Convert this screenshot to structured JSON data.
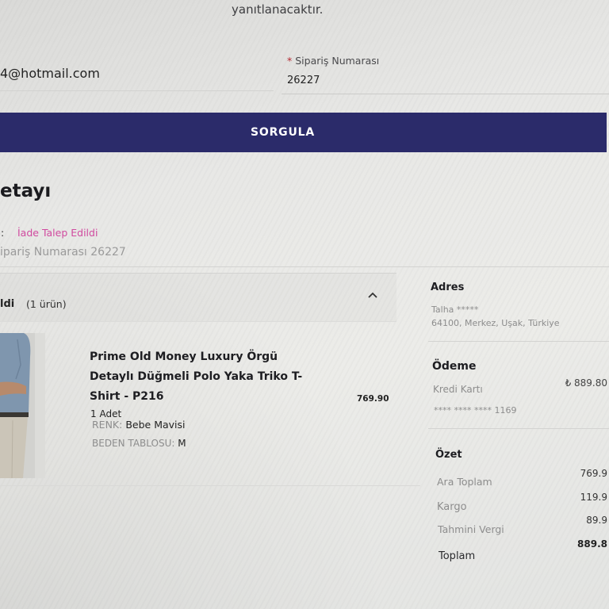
{
  "top_note": "yanıtlanacaktır.",
  "query_form": {
    "email_value": "4@hotmail.com",
    "required_mark": "*",
    "order_label": "Sipariş Numarası",
    "order_value": "26227",
    "submit_label": "SORGULA",
    "submit_color": "#2b2b6a"
  },
  "order_detail": {
    "title": "etayı",
    "status_prefix": ":",
    "status": "İade Talep Edildi",
    "status_color": "#d04a9f",
    "order_number_text": "ipariş Numarası 26227"
  },
  "shipment": {
    "heading": "ldi",
    "count": "(1 ürün)",
    "toggle_icon": "chevron-up-icon"
  },
  "product": {
    "name": "Prime Old Money Luxury Örgü Detaylı Düğmeli Polo Yaka Triko T-Shirt - P216",
    "quantity": "1 Adet",
    "color_label": "RENK:",
    "color_value": "Bebe Mavisi",
    "size_label": "BEDEN TABLOSU:",
    "size_value": "M",
    "price": "769.90"
  },
  "address": {
    "heading": "Adres",
    "name": "Talha *****",
    "line": "64100, Merkez, Uşak, Türkiye"
  },
  "payment": {
    "heading": "Ödeme",
    "method": "Kredi Kartı",
    "amount": "₺ 889.80",
    "card": "**** **** **** 1169"
  },
  "summary": {
    "heading": "Özet",
    "rows": [
      {
        "label": "Ara Toplam",
        "value": "769.9"
      },
      {
        "label": "Kargo",
        "value": "119.9"
      },
      {
        "label": "Tahmini Vergi",
        "value": "89.9"
      },
      {
        "label": "Toplam",
        "value": "889.8"
      }
    ]
  }
}
